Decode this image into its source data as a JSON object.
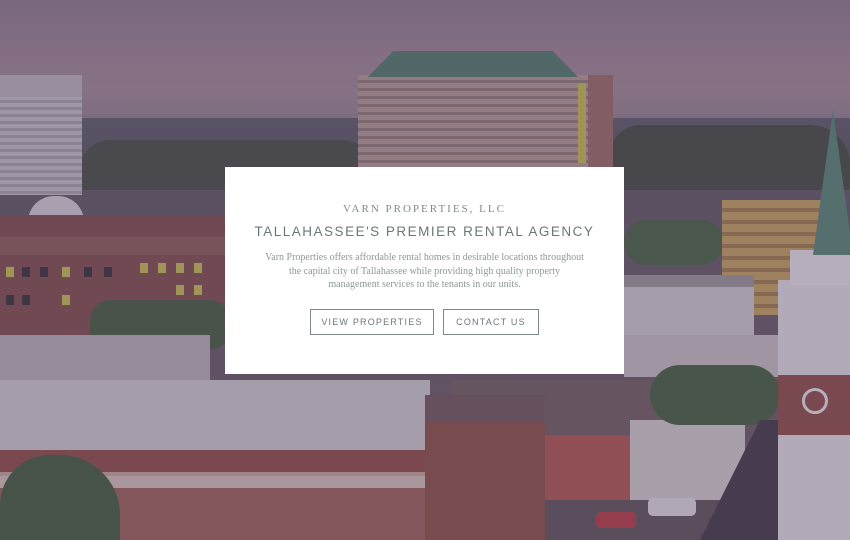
{
  "hero": {
    "company_name": "VARN PROPERTIES, LLC",
    "headline": "TALLAHASSEE'S PREMIER RENTAL AGENCY",
    "description": "Varn Properties offers affordable rental homes in desirable locations throughout the capital city of Tallahassee while providing high quality property management services to the tenants in our units.",
    "buttons": {
      "view_properties": "VIEW PROPERTIES",
      "contact_us": "CONTACT US"
    }
  },
  "background": {
    "subject": "city-skyline-photo",
    "overlay_color": "#5c4a6a"
  },
  "colors": {
    "card_background": "#ffffff",
    "text_teal_grey": "#6c7877",
    "button_border": "#7d8a89"
  }
}
